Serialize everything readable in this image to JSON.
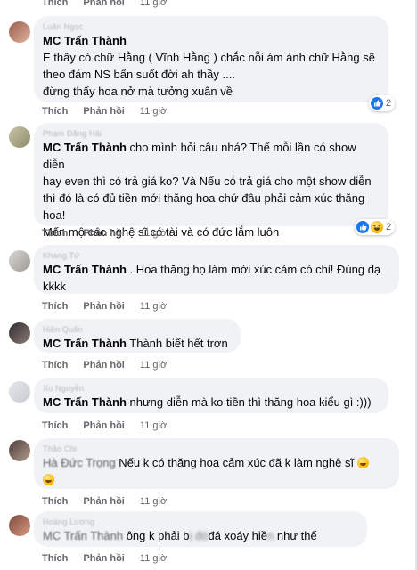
{
  "top_actions": {
    "like": "Thích",
    "reply": "Phản hồi",
    "time": "11 giờ"
  },
  "comments": [
    {
      "author": "Luân Ngọc",
      "text_lines": [
        "E thấy có chữ Hằng ( Vĩnh Hằng ) chắc nỗi ám ảnh chữ Hằng sẽ",
        "theo đám NS bẩn suốt đời ah thầy ....",
        "đừng thấy hoa nở mà tưởng xuân về"
      ],
      "tag": "MC Trấn Thành",
      "reaction_count": "2",
      "actions": {
        "like": "Thích",
        "reply": "Phản hồi",
        "time": "11 giờ"
      }
    },
    {
      "author": "Phạm Đăng Hải",
      "tag": "MC Trấn Thành",
      "text_lines": [
        " cho mình hỏi câu nhá? Thế mỗi lần có show diễn",
        "hay even thì có trả giá ko? Và Nếu có trả giá cho một show diễn",
        "thì đó là có đủ tiền mới thăng hoa chứ đâu phải cảm xúc thăng",
        "hoa!",
        "Mến mộ các nghệ sĩ có tài và có đức lắm luôn"
      ],
      "reaction_count": "2",
      "actions": {
        "like": "Thích",
        "reply": "Phản hồi",
        "time": "11 giờ"
      }
    },
    {
      "author": "Khang Tứ",
      "tag": "MC Trấn Thành",
      "text_lines": [
        " . Hoa thăng họ làm mới xúc cảm có chỉ! Đúng dạ",
        "kkkk"
      ],
      "actions": {
        "like": "Thích",
        "reply": "Phản hồi",
        "time": "11 giờ"
      }
    },
    {
      "author": "Hiền Quân",
      "tag": "MC Trấn Thành",
      "text_lines": [
        " Thành biết hết trơn"
      ],
      "actions": {
        "like": "Thích",
        "reply": "Phản hồi",
        "time": "11 giờ"
      }
    },
    {
      "author": "Xu Nguyễn",
      "tag": "MC Trấn Thành",
      "text_lines": [
        " nhưng diễn mà ko tiền thì thăng hoa kiểu gì :)))"
      ],
      "actions": {
        "like": "Thích",
        "reply": "Phản hồi",
        "time": "11 giờ"
      }
    },
    {
      "author": "Thảo Chi",
      "tag": "Hà Đức Trọng",
      "text_lines": [
        " Nếu k có thăng hoa cảm xúc đã k làm nghệ sĩ"
      ],
      "actions": {
        "like": "Thích",
        "reply": "Phản hồi",
        "time": "11 giờ"
      }
    },
    {
      "author": "Hoàng Lương",
      "tag": "MC Trấn Thành",
      "text_a": " ông k phải b",
      "text_blur": "ị đó",
      "text_b": "đá xoáy hiề",
      "text_blur2": "n",
      "text_c": " như thế",
      "actions": {
        "like": "Thích",
        "reply": "Phản hồi",
        "time": "11 giờ"
      }
    }
  ],
  "colors": {
    "bubble": "#f0f2f5",
    "like_blue": "#1877f2",
    "haha_yellow": "#f7b500",
    "meta": "#65676b"
  },
  "icons": [
    "avatar",
    "like-reaction-icon",
    "haha-reaction-icon",
    "grin-emoji-icon"
  ]
}
